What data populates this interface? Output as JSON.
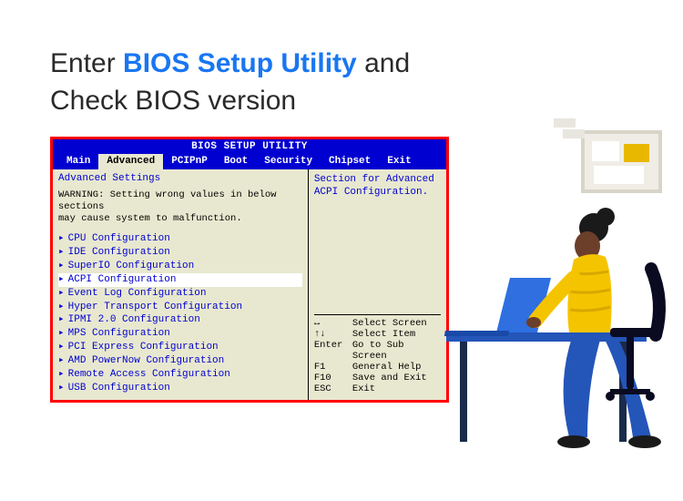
{
  "page_title": {
    "prefix": "Enter ",
    "highlight": "BIOS Setup Utility",
    "suffix1": " and",
    "line2": "Check BIOS version"
  },
  "bios": {
    "title": "BIOS SETUP UTILITY",
    "tabs": [
      "Main",
      "Advanced",
      "PCIPnP",
      "Boot",
      "Security",
      "Chipset",
      "Exit"
    ],
    "selected_tab": "Advanced",
    "section_title": "Advanced Settings",
    "warning_label": "WARNING:",
    "warning_text": "Setting wrong values in below sections\nmay cause system to malfunction.",
    "items": [
      "CPU Configuration",
      "IDE Configuration",
      "SuperIO Configuration",
      "ACPI Configuration",
      "Event Log Configuration",
      "Hyper Transport Configuration",
      "IPMI 2.0 Configuration",
      "MPS Configuration",
      "PCI Express Configuration",
      "AMD PowerNow Configuration",
      "Remote Access Configuration",
      "USB Configuration"
    ],
    "highlighted_item_index": 3,
    "help": {
      "line1": "Section for Advanced",
      "line2": "ACPI Configuration."
    },
    "keys": [
      {
        "k": "↔",
        "v": "Select Screen"
      },
      {
        "k": "↑↓",
        "v": "Select Item"
      },
      {
        "k": "Enter",
        "v": "Go to Sub Screen"
      },
      {
        "k": "F1",
        "v": "General Help"
      },
      {
        "k": "F10",
        "v": "Save and Exit"
      },
      {
        "k": "ESC",
        "v": "Exit"
      }
    ]
  }
}
